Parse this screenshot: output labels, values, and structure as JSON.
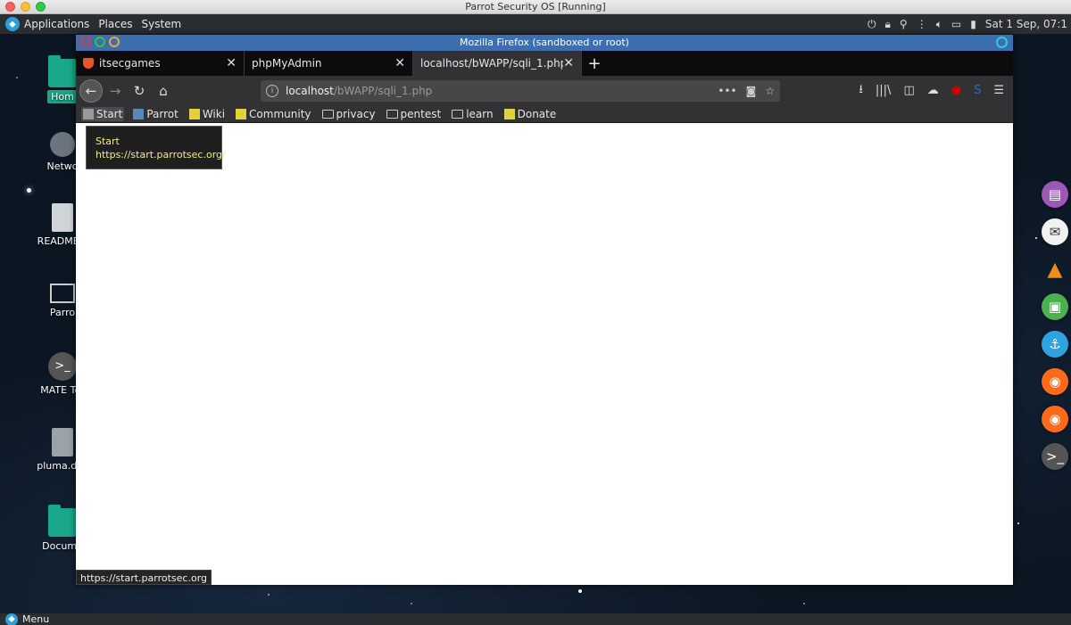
{
  "host": {
    "title": "Parrot Security OS [Running]"
  },
  "top_panel": {
    "menus": [
      "Applications",
      "Places",
      "System"
    ],
    "clock": "Sat  1 Sep, 07:1"
  },
  "desktop": {
    "icons": [
      "Hom",
      "Netwo",
      "README.li",
      "Parro",
      "MATE Ter",
      "pluma.des",
      "Docume"
    ]
  },
  "bottom_panel": {
    "menu_label": "Menu"
  },
  "firefox": {
    "window_title": "Mozilla Firefox (sandboxed or root)",
    "tabs": [
      {
        "label": "itsecgames",
        "active": false
      },
      {
        "label": "phpMyAdmin",
        "active": false
      },
      {
        "label": "localhost/bWAPP/sqli_1.php",
        "active": true
      }
    ],
    "url": {
      "host": "localhost",
      "path": "/bWAPP/sqli_1.php"
    },
    "bookmarks": [
      "Start",
      "Parrot",
      "Wiki",
      "Community",
      "privacy",
      "pentest",
      "learn",
      "Donate"
    ],
    "tooltip": {
      "title": "Start",
      "url": "https://start.parrotsec.org/"
    },
    "status_url": "https://start.parrotsec.org"
  },
  "colors": {
    "firefox_titlebar": "#3c6fb0",
    "tooltip_text": "#f3ec7a",
    "folder_teal": "#1aa88a"
  }
}
